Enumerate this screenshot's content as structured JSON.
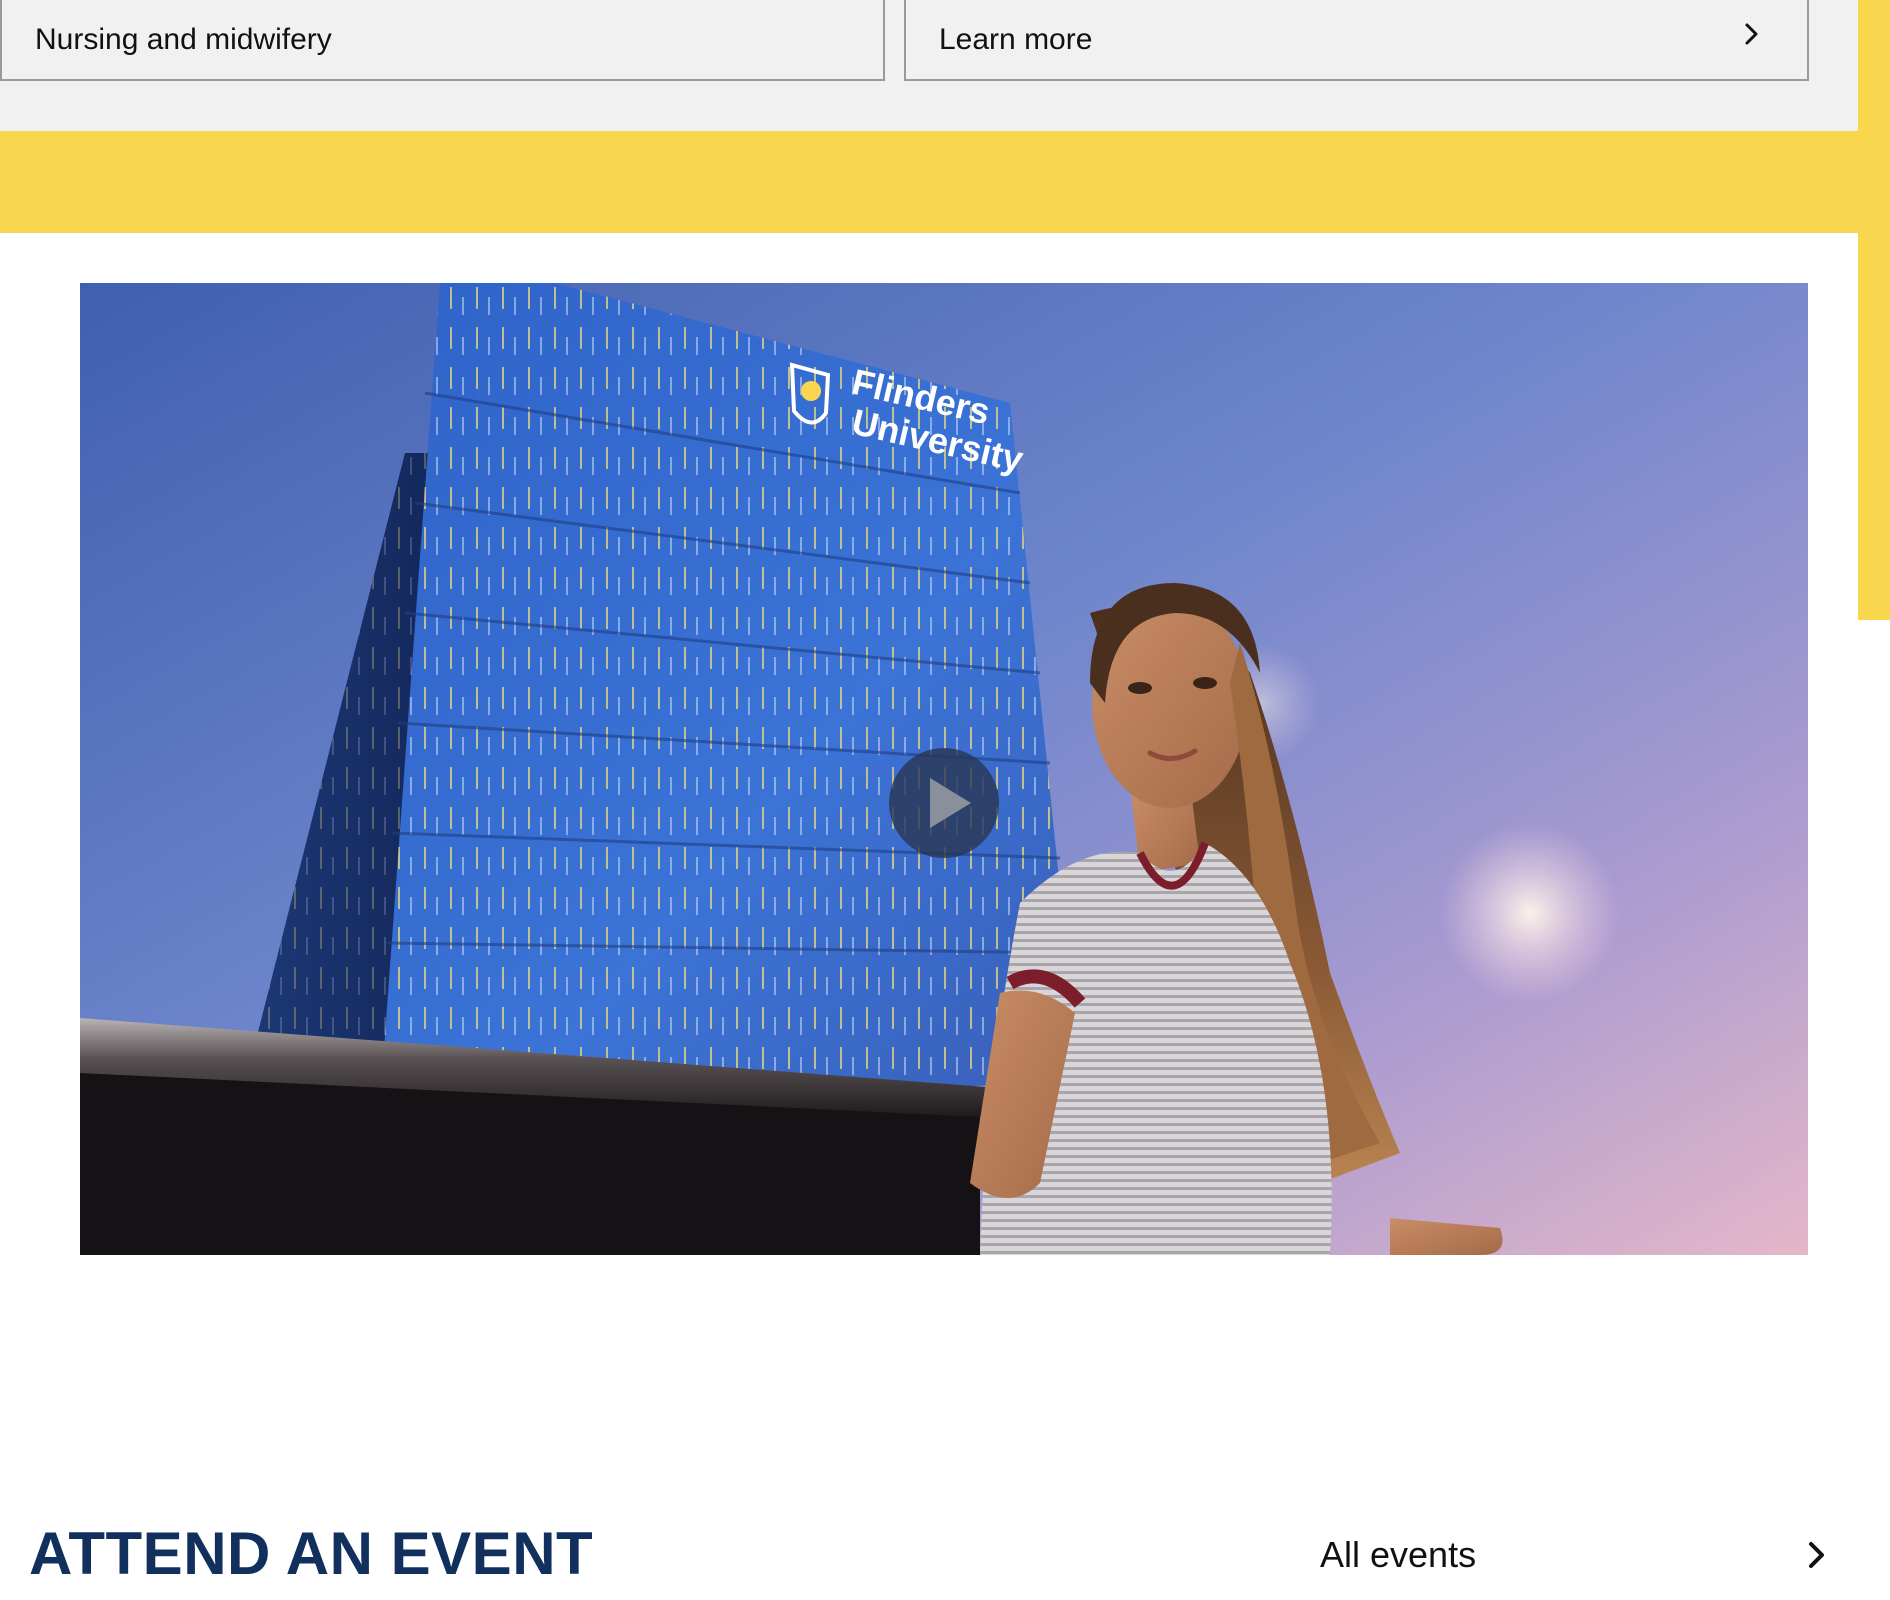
{
  "program_row": {
    "course_name": "Nursing and midwifery",
    "link_label": "Learn more",
    "link_icon": "chevron-right-icon"
  },
  "video": {
    "sign_line_1": "Flinders",
    "sign_line_2": "University",
    "play_icon": "play-icon"
  },
  "events": {
    "heading": "ATTEND AN EVENT",
    "link_label": "All events",
    "link_icon": "chevron-right-icon"
  },
  "colors": {
    "band_gray": "#f1f1f1",
    "accent_yellow": "#f8d64e",
    "heading_navy": "#12305e"
  }
}
